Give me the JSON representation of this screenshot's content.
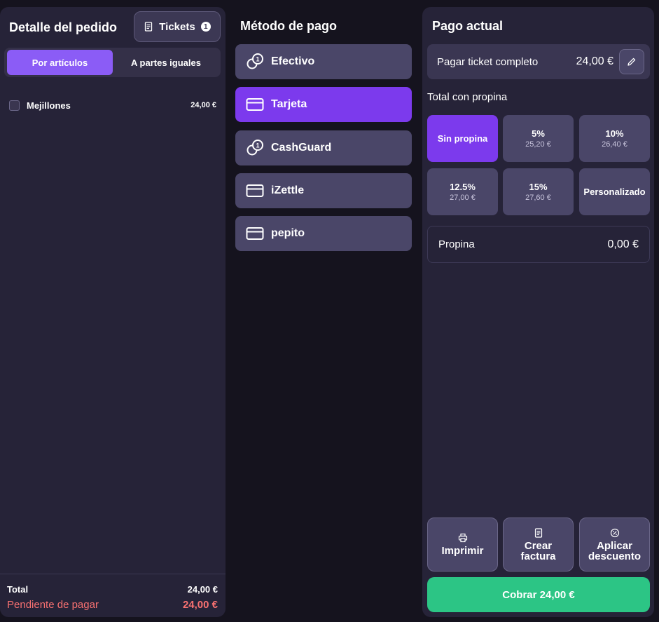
{
  "order": {
    "title": "Detalle del pedido",
    "tickets_label": "Tickets",
    "tickets_count": "1",
    "tabs": [
      "Por artículos",
      "A partes iguales"
    ],
    "items": [
      {
        "name": "Mejillones",
        "price": "24,00 €"
      }
    ],
    "total_label": "Total",
    "total_value": "24,00 €",
    "pending_label": "Pendiente de pagar",
    "pending_value": "24,00 €"
  },
  "payment": {
    "title": "Método de pago",
    "methods": [
      {
        "label": "Efectivo",
        "icon": "coins-icon"
      },
      {
        "label": "Tarjeta",
        "icon": "card-icon",
        "selected": true
      },
      {
        "label": "CashGuard",
        "icon": "coins-icon"
      },
      {
        "label": "iZettle",
        "icon": "card-icon"
      },
      {
        "label": "pepito",
        "icon": "card-icon"
      }
    ]
  },
  "current": {
    "title": "Pago actual",
    "full_ticket_label": "Pagar ticket completo",
    "full_ticket_amount": "24,00 €",
    "tip_section_label": "Total con propina",
    "tips": [
      {
        "label": "Sin propina",
        "sub": "",
        "selected": true
      },
      {
        "label": "5%",
        "sub": "25,20 €"
      },
      {
        "label": "10%",
        "sub": "26,40 €"
      },
      {
        "label": "12.5%",
        "sub": "27,00 €"
      },
      {
        "label": "15%",
        "sub": "27,60 €"
      },
      {
        "label": "Personalizado",
        "sub": ""
      }
    ],
    "propina_label": "Propina",
    "propina_value": "0,00 €",
    "actions": [
      {
        "line1": "Imprimir",
        "line2": ""
      },
      {
        "line1": "Crear",
        "line2": "factura"
      },
      {
        "line1": "Aplicar",
        "line2": "descuento"
      }
    ],
    "charge_label": "Cobrar 24,00 €"
  },
  "colors": {
    "accent": "#7c3aed",
    "accent_light": "#8b5cf6",
    "success": "#2cc585",
    "danger": "#f87171"
  }
}
